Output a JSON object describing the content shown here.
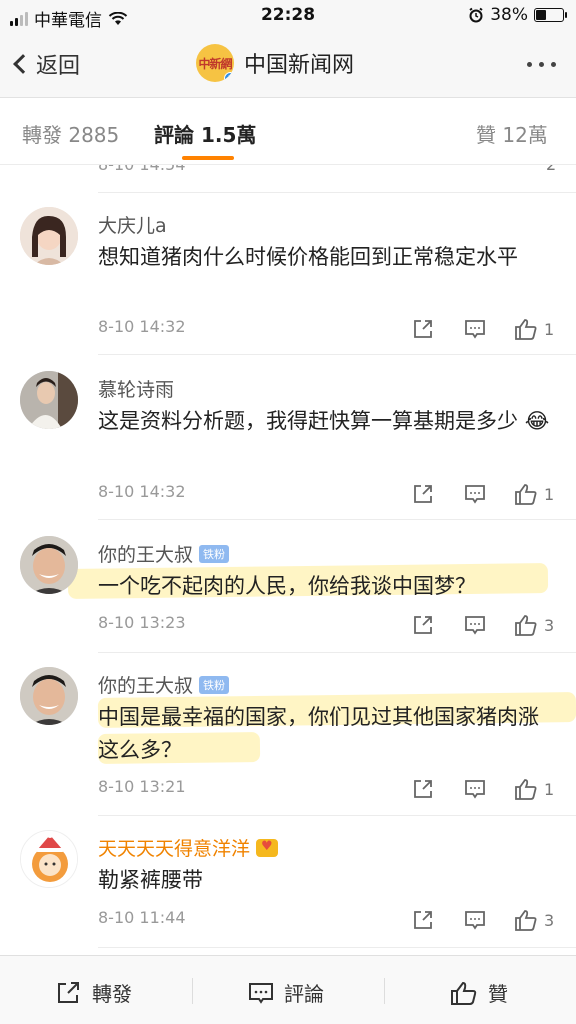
{
  "status_bar": {
    "carrier": "中華電信",
    "time": "22:28",
    "battery": "38%",
    "battery_level": 0.38
  },
  "nav": {
    "back_label": "返回",
    "title": "中国新闻网",
    "logo_text": "中新網"
  },
  "tabs": [
    {
      "label": "轉發 2885"
    },
    {
      "label": "評論 1.5萬"
    },
    {
      "label": "贊 12萬"
    }
  ],
  "partial_comment": {
    "time": "8-10 14:54",
    "likes": "2"
  },
  "comments": [
    {
      "name": "大庆儿a",
      "text": "想知道猪肉什么时候价格能回到正常稳定水平",
      "time": "8-10 14:32",
      "likes": "1"
    },
    {
      "name": "慕轮诗雨",
      "text": "这是资料分析题，我得赶快算一算基期是多少",
      "emoji": "😂",
      "time": "8-10 14:32",
      "likes": "1"
    },
    {
      "name": "你的王大叔",
      "badge": "铁粉",
      "text": "一个吃不起肉的人民，你给我谈中国梦？",
      "time": "8-10 13:23",
      "likes": "3"
    },
    {
      "name": "你的王大叔",
      "badge": "铁粉",
      "text": "中国是最幸福的国家，你们见过其他国家猪肉涨这么多？",
      "time": "8-10 13:21",
      "likes": "1"
    },
    {
      "name": "天天天天得意洋洋",
      "text": "勒紧裤腰带",
      "time": "8-10 11:44",
      "likes": "3"
    }
  ],
  "bottom_bar": {
    "repost_label": "轉發",
    "comment_label": "評論",
    "like_label": "贊"
  },
  "colors": {
    "accent": "#ff8200",
    "gold_name": "#f08300",
    "highlight": "#ffec96"
  }
}
